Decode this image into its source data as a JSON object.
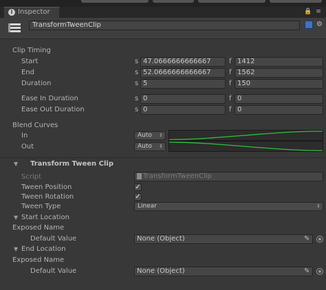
{
  "window": {
    "tab_label": "Inspector"
  },
  "header": {
    "name": "TransformTweenClip"
  },
  "clip_timing": {
    "title": "Clip Timing",
    "rows": [
      {
        "label": "Start",
        "s_unit": "s",
        "s_value": "47.0666666666667",
        "f_unit": "f",
        "f_value": "1412"
      },
      {
        "label": "End",
        "s_unit": "s",
        "s_value": "52.0666666666667",
        "f_unit": "f",
        "f_value": "1562"
      },
      {
        "label": "Duration",
        "s_unit": "s",
        "s_value": "5",
        "f_unit": "f",
        "f_value": "150"
      },
      {
        "label": "Ease In Duration",
        "s_unit": "s",
        "s_value": "0",
        "f_unit": "f",
        "f_value": "0"
      },
      {
        "label": "Ease Out Duration",
        "s_unit": "s",
        "s_value": "0",
        "f_unit": "f",
        "f_value": "0"
      }
    ]
  },
  "blend_curves": {
    "title": "Blend Curves",
    "in": {
      "label": "In",
      "mode": "Auto"
    },
    "out": {
      "label": "Out",
      "mode": "Auto"
    },
    "curve_color": "#2fbf3a"
  },
  "component": {
    "title": "Transform Tween Clip",
    "script_label": "Script",
    "script_value": "TransformTweenClip",
    "tween_position_label": "Tween Position",
    "tween_position_checked": true,
    "tween_rotation_label": "Tween Rotation",
    "tween_rotation_checked": true,
    "tween_type_label": "Tween Type",
    "tween_type_value": "Linear"
  },
  "start_location": {
    "title": "Start Location",
    "exposed_name_label": "Exposed Name",
    "default_value_label": "Default Value",
    "default_value": "None (Object)"
  },
  "end_location": {
    "title": "End Location",
    "exposed_name_label": "Exposed Name",
    "default_value_label": "Default Value",
    "default_value": "None (Object)"
  },
  "glyphs": {
    "check": "✓",
    "updown": "⇕",
    "tab_icon": "i",
    "settings": "⚙"
  }
}
